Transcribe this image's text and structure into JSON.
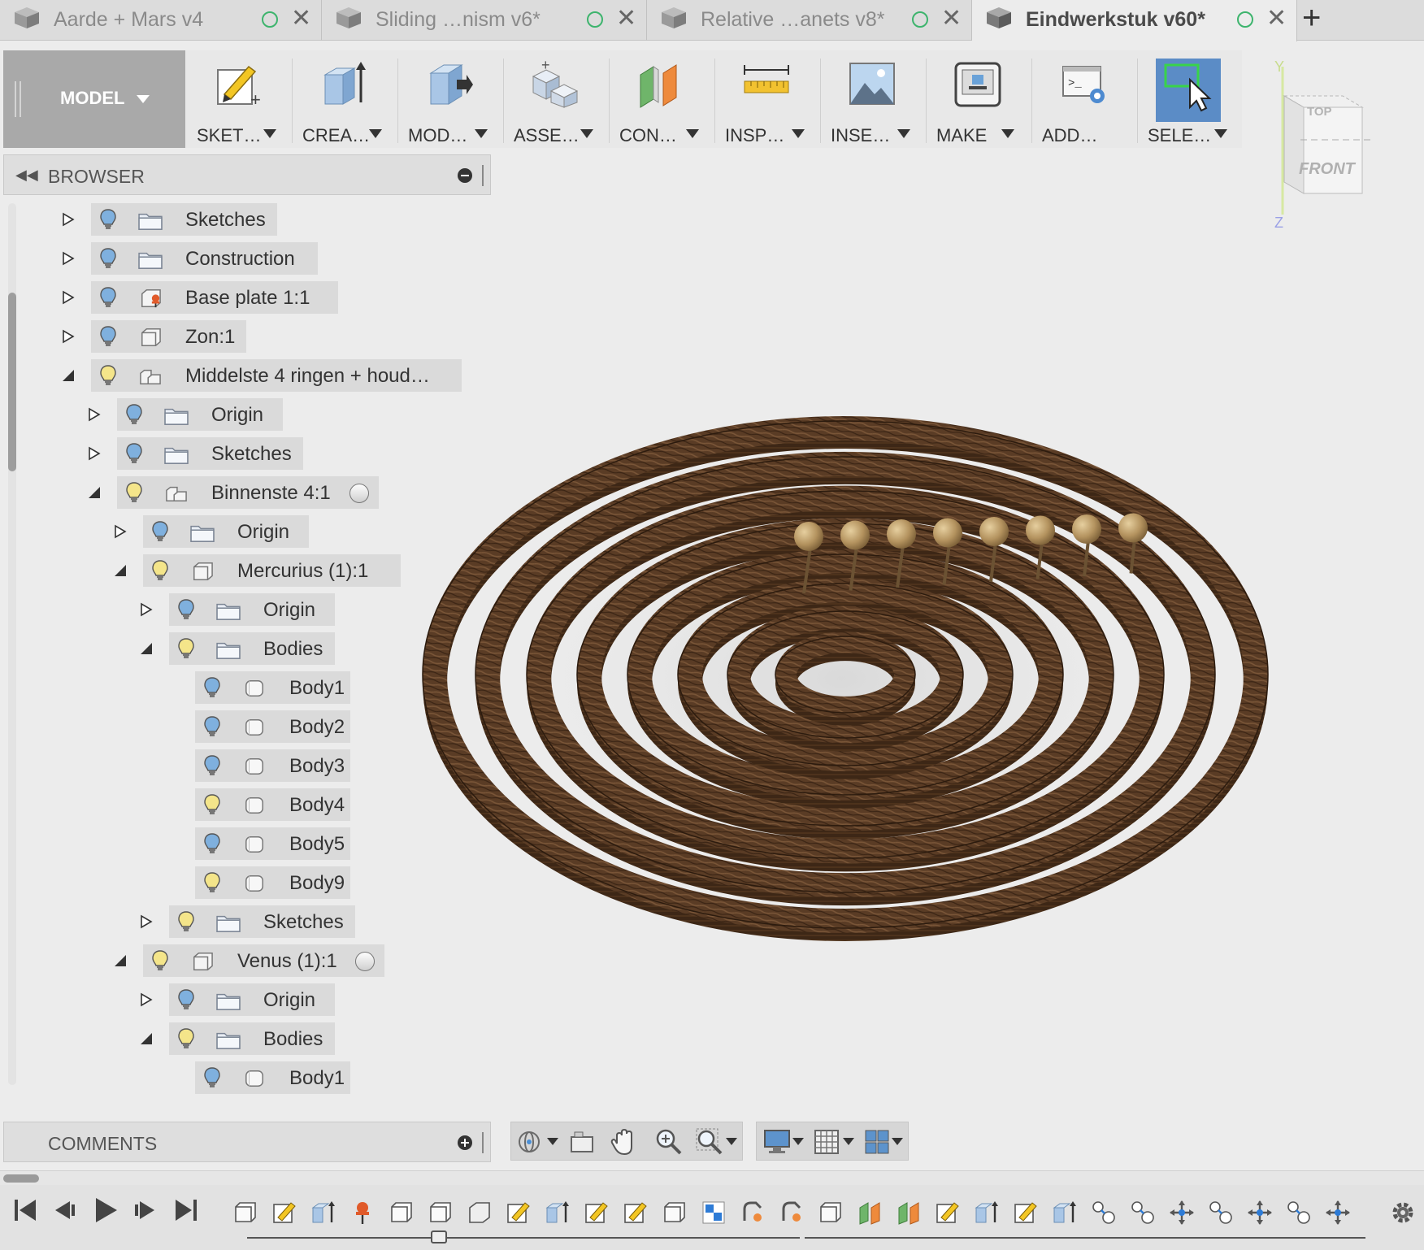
{
  "tabs": [
    {
      "label": "Aarde + Mars v4",
      "active": false
    },
    {
      "label": "Sliding …nism v6*",
      "active": false
    },
    {
      "label": "Relative …anets v8*",
      "active": false
    },
    {
      "label": "Eindwerkstuk v60*",
      "active": true
    }
  ],
  "new_tab_label": "+",
  "toolbar": {
    "workspace": "MODEL",
    "tools": [
      {
        "label": "SKET…",
        "icon": "sketch-icon"
      },
      {
        "label": "CREA…",
        "icon": "create-icon"
      },
      {
        "label": "MOD…",
        "icon": "modify-icon"
      },
      {
        "label": "ASSE…",
        "icon": "assemble-icon"
      },
      {
        "label": "CON…",
        "icon": "construct-icon"
      },
      {
        "label": "INSP…",
        "icon": "inspect-icon"
      },
      {
        "label": "INSE…",
        "icon": "insert-icon"
      },
      {
        "label": "MAKE",
        "icon": "make-icon"
      },
      {
        "label": "ADD…",
        "icon": "add-ins-icon"
      },
      {
        "label": "SELE…",
        "icon": "select-icon"
      }
    ]
  },
  "viewcube": {
    "top": "TOP",
    "front": "FRONT",
    "axis_y": "Y",
    "axis_z": "Z"
  },
  "browser": {
    "title": "BROWSER",
    "nodes": [
      {
        "label": "Sketches",
        "level": 0,
        "expanded": false,
        "icon": "folder",
        "bulb": "blue"
      },
      {
        "label": "Construction",
        "level": 0,
        "expanded": false,
        "icon": "folder",
        "bulb": "blue"
      },
      {
        "label": "Base plate 1:1",
        "level": 0,
        "expanded": false,
        "icon": "pinned-component",
        "bulb": "blue"
      },
      {
        "label": "Zon:1",
        "level": 0,
        "expanded": false,
        "icon": "component",
        "bulb": "blue"
      },
      {
        "label": "Middelste 4 ringen + houd…",
        "level": 0,
        "expanded": true,
        "icon": "assembly",
        "bulb": "yellow"
      },
      {
        "label": "Origin",
        "level": 1,
        "expanded": false,
        "icon": "folder",
        "bulb": "blue"
      },
      {
        "label": "Sketches",
        "level": 1,
        "expanded": false,
        "icon": "folder",
        "bulb": "blue"
      },
      {
        "label": "Binnenste 4:1",
        "level": 1,
        "expanded": true,
        "icon": "assembly",
        "bulb": "yellow",
        "radio": true
      },
      {
        "label": "Origin",
        "level": 2,
        "expanded": false,
        "icon": "folder",
        "bulb": "blue"
      },
      {
        "label": "Mercurius (1):1",
        "level": 2,
        "expanded": true,
        "icon": "component",
        "bulb": "yellow"
      },
      {
        "label": "Origin",
        "level": 3,
        "expanded": false,
        "icon": "folder",
        "bulb": "blue"
      },
      {
        "label": "Bodies",
        "level": 3,
        "expanded": true,
        "icon": "folder",
        "bulb": "yellow"
      },
      {
        "label": "Body1",
        "level": 4,
        "icon": "body",
        "bulb": "blue"
      },
      {
        "label": "Body2",
        "level": 4,
        "icon": "body",
        "bulb": "blue"
      },
      {
        "label": "Body3",
        "level": 4,
        "icon": "body",
        "bulb": "blue"
      },
      {
        "label": "Body4",
        "level": 4,
        "icon": "body",
        "bulb": "yellow"
      },
      {
        "label": "Body5",
        "level": 4,
        "icon": "body",
        "bulb": "blue"
      },
      {
        "label": "Body9",
        "level": 4,
        "icon": "body",
        "bulb": "yellow"
      },
      {
        "label": "Sketches",
        "level": 3,
        "expanded": false,
        "icon": "folder",
        "bulb": "yellow"
      },
      {
        "label": "Venus (1):1",
        "level": 2,
        "expanded": true,
        "icon": "component",
        "bulb": "yellow",
        "radio": true
      },
      {
        "label": "Origin",
        "level": 3,
        "expanded": false,
        "icon": "folder",
        "bulb": "blue"
      },
      {
        "label": "Bodies",
        "level": 3,
        "expanded": true,
        "icon": "folder",
        "bulb": "yellow"
      },
      {
        "label": "Body1",
        "level": 4,
        "icon": "body",
        "bulb": "blue"
      }
    ]
  },
  "comments": {
    "title": "COMMENTS"
  },
  "navbar": {
    "items": [
      "orbit-icon",
      "look-at-icon",
      "pan-icon",
      "zoom-icon",
      "zoom-window-icon",
      "display-settings-icon",
      "grid-settings-icon",
      "viewports-icon"
    ]
  },
  "timeline": {
    "controls": [
      "skip-to-start-icon",
      "step-back-icon",
      "play-icon",
      "step-forward-icon",
      "skip-to-end-icon"
    ],
    "features": [
      "component",
      "sketch",
      "extrude",
      "pin",
      "component",
      "component",
      "body",
      "sketch",
      "extrude",
      "sketch",
      "sketch",
      "component",
      "joint-origin",
      "rigid",
      "rigid",
      "component",
      "construct-plane",
      "construct-plane",
      "sketch",
      "extrude",
      "sketch",
      "extrude",
      "joint",
      "joint",
      "move",
      "joint",
      "move",
      "joint",
      "move"
    ]
  },
  "colors": {
    "wood_dark": "#4a3120",
    "wood_mid": "#6b4a30",
    "ball": "#a98a5a",
    "bulb_blue": "#7fb0de",
    "bulb_yellow": "#f4e58a",
    "select_blue": "#5b8cc6"
  }
}
